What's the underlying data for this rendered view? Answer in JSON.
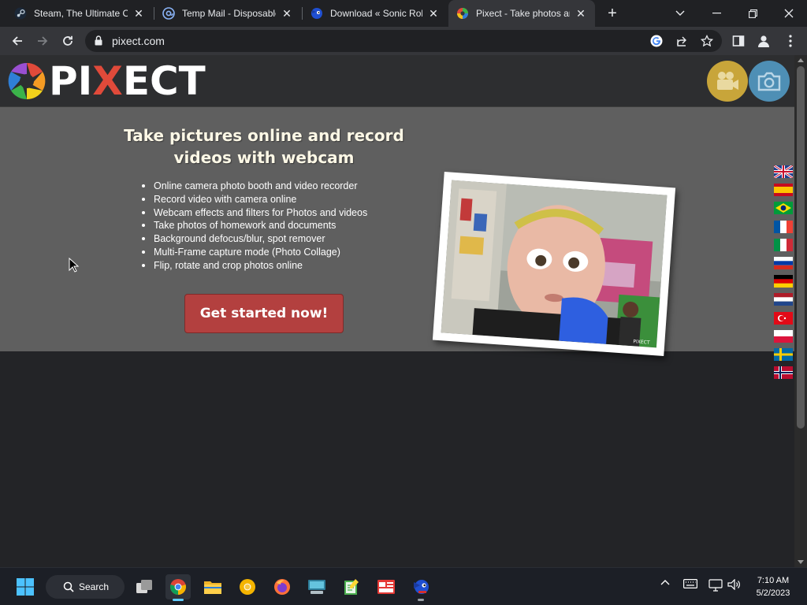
{
  "browser": {
    "tabs": [
      {
        "title": "Steam, The Ultimate Or",
        "favicon": "steam-icon"
      },
      {
        "title": "Temp Mail - Disposable",
        "favicon": "at-icon"
      },
      {
        "title": "Download « Sonic Rob",
        "favicon": "sonic-icon"
      },
      {
        "title": "Pixect - Take photos an",
        "favicon": "pixect-icon",
        "active": true
      }
    ],
    "url": "pixect.com"
  },
  "site": {
    "logo_text": "PIXECT",
    "hero": {
      "heading": "Take pictures online and record videos with webcam",
      "features": [
        "Online camera photo booth and video recorder",
        "Record video with camera online",
        "Webcam effects and filters for Photos and videos",
        "Take photos of homework and documents",
        "Background defocus/blur, spot remover",
        "Multi-Frame capture mode (Photo Collage)",
        "Flip, rotate and crop photos online"
      ],
      "cta": "Get started now!",
      "photo_watermark": "PIXECT"
    },
    "flags": [
      "uk-flag",
      "spain-flag",
      "brazil-flag",
      "france-flag",
      "italy-flag",
      "russia-flag",
      "germany-flag",
      "netherlands-flag",
      "turkey-flag",
      "poland-flag",
      "sweden-flag",
      "norway-flag"
    ],
    "colors": {
      "cta": "#b3403f",
      "hero_bg": "#5f5f5f",
      "header_bg": "#2d2e30",
      "video_btn": "#c8a53a",
      "camera_btn": "#4e8fb5"
    }
  },
  "taskbar": {
    "search_label": "Search",
    "time": "7:10 AM",
    "date": "5/2/2023"
  }
}
